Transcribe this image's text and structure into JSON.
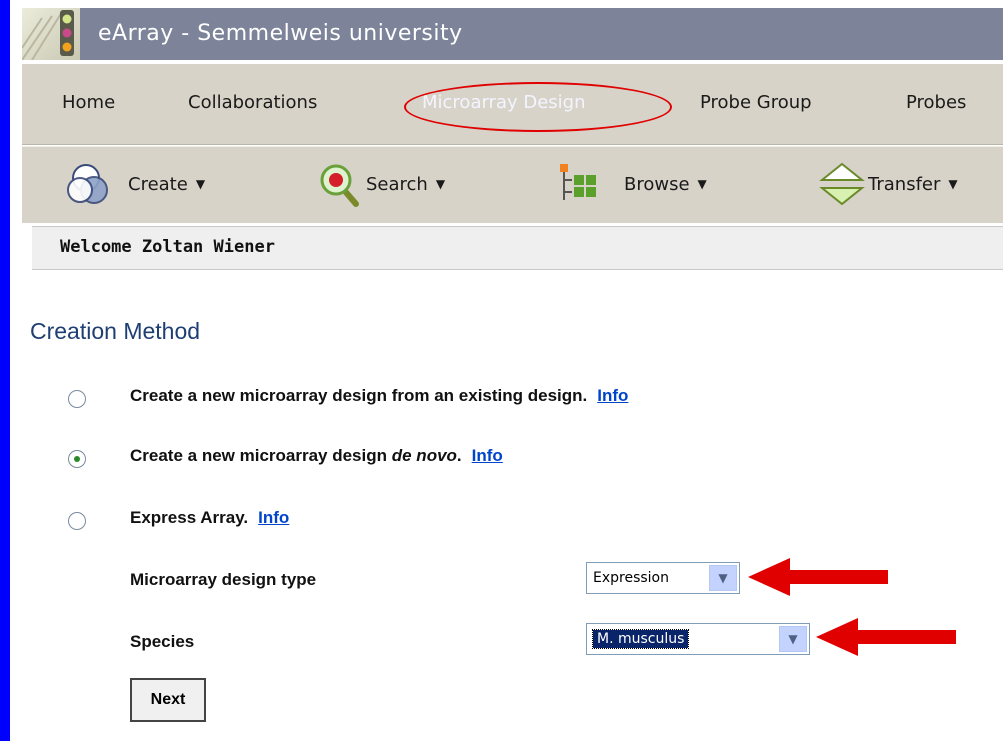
{
  "app": {
    "title": "eArray - Semmelweis university"
  },
  "nav": {
    "items": [
      "Home",
      "Collaborations",
      "Microarray Design",
      "Probe Group",
      "Probes"
    ]
  },
  "toolbar": {
    "create_label": "Create",
    "search_label": "Search",
    "browse_label": "Browse",
    "transfer_label": "Transfer"
  },
  "welcome": {
    "text": "Welcome Zoltan Wiener"
  },
  "creation": {
    "title": "Creation Method",
    "options": [
      {
        "label": "Create a new microarray design from an existing design.",
        "info": "Info",
        "checked": false
      },
      {
        "label_prefix": "Create a new microarray design",
        "label_em": "de novo",
        "label_suffix": ".",
        "info": "Info",
        "checked": true
      },
      {
        "label": "Express Array.",
        "info": "Info",
        "checked": false
      }
    ],
    "design_type_label": "Microarray design type",
    "design_type_value": "Expression",
    "species_label": "Species",
    "species_value": "M. musculus",
    "next_label": "Next"
  },
  "colors": {
    "title_bar": "#7d8499",
    "nav_bg": "#d7d3c8",
    "frame_blue": "#0000ff",
    "annotation_red": "#e00000",
    "heading": "#1f3f73"
  }
}
